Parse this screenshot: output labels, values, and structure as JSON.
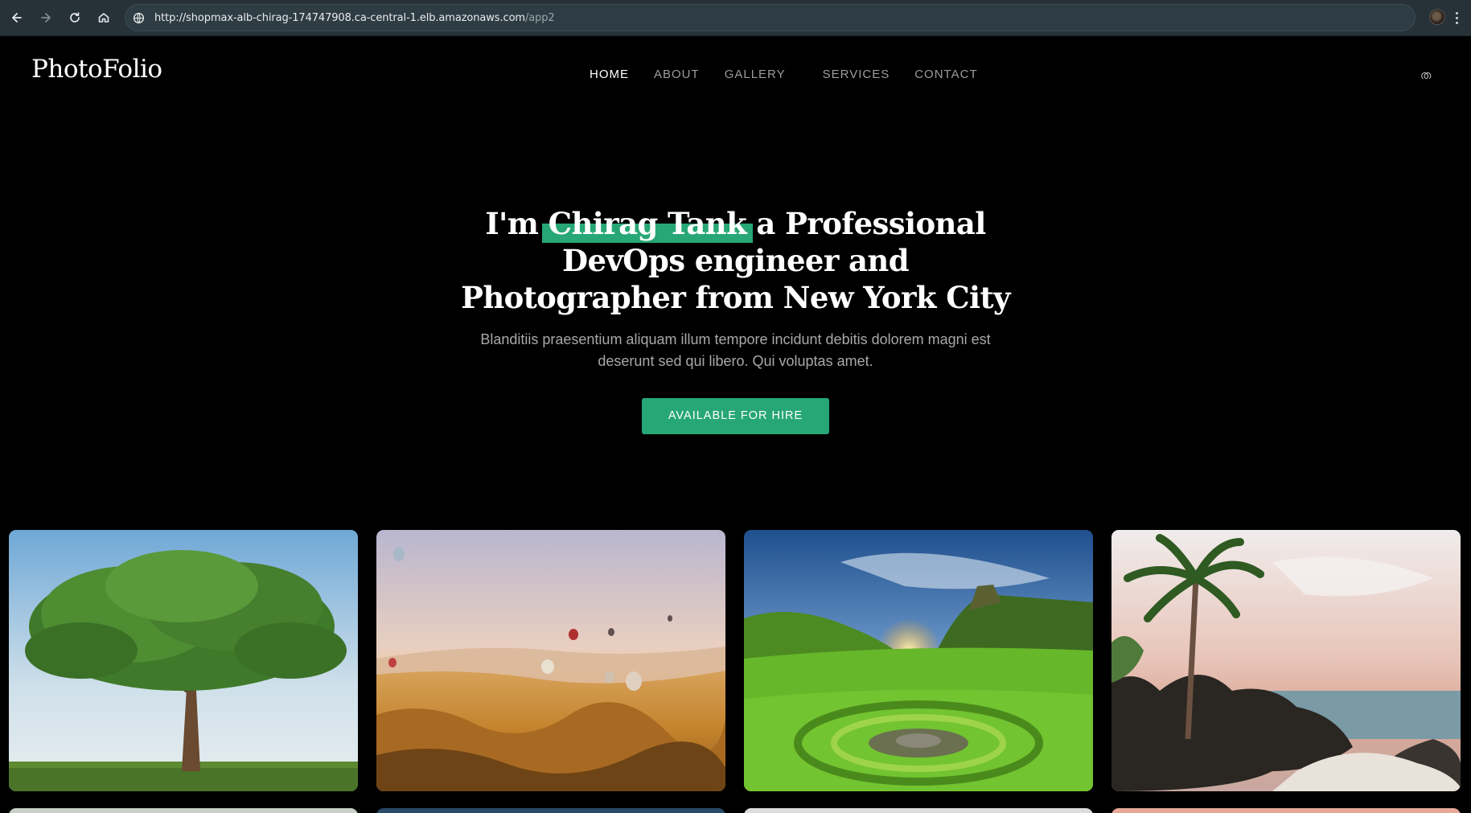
{
  "browser": {
    "url_host": "http://shopmax-alb-chirag-174747908.ca-central-1.elb.amazonaws.com",
    "url_path": "/app2",
    "icons": [
      "back-arrow-icon",
      "forward-arrow-icon",
      "reload-icon",
      "home-icon",
      "site-info-icon",
      "profile-avatar",
      "menu-dots-icon"
    ]
  },
  "header": {
    "logo": "PhotoFolio",
    "nav": [
      {
        "label": "HOME",
        "active": true
      },
      {
        "label": "ABOUT",
        "active": false
      },
      {
        "label": "GALLERY",
        "active": false
      },
      {
        "label": "SERVICES",
        "active": false
      },
      {
        "label": "CONTACT",
        "active": false
      }
    ],
    "right_icon_glyph": "ത"
  },
  "hero": {
    "title_prefix": "I'm ",
    "title_name": "Chirag Tank",
    "title_rest": " a Professional DevOps engineer and Photographer from New York City",
    "subtitle": "Blanditiis praesentium aliquam illum tempore incidunt debitis dolorem magni est deserunt sed qui libero. Qui voluptas amet.",
    "cta_label": "AVAILABLE FOR HIRE"
  },
  "colors": {
    "accent": "#27a776",
    "background": "#000000",
    "browser_bar": "#263238"
  },
  "gallery": {
    "items": [
      "tree",
      "hot-air-balloons",
      "green-valley-sunset",
      "tropical-beach"
    ]
  }
}
